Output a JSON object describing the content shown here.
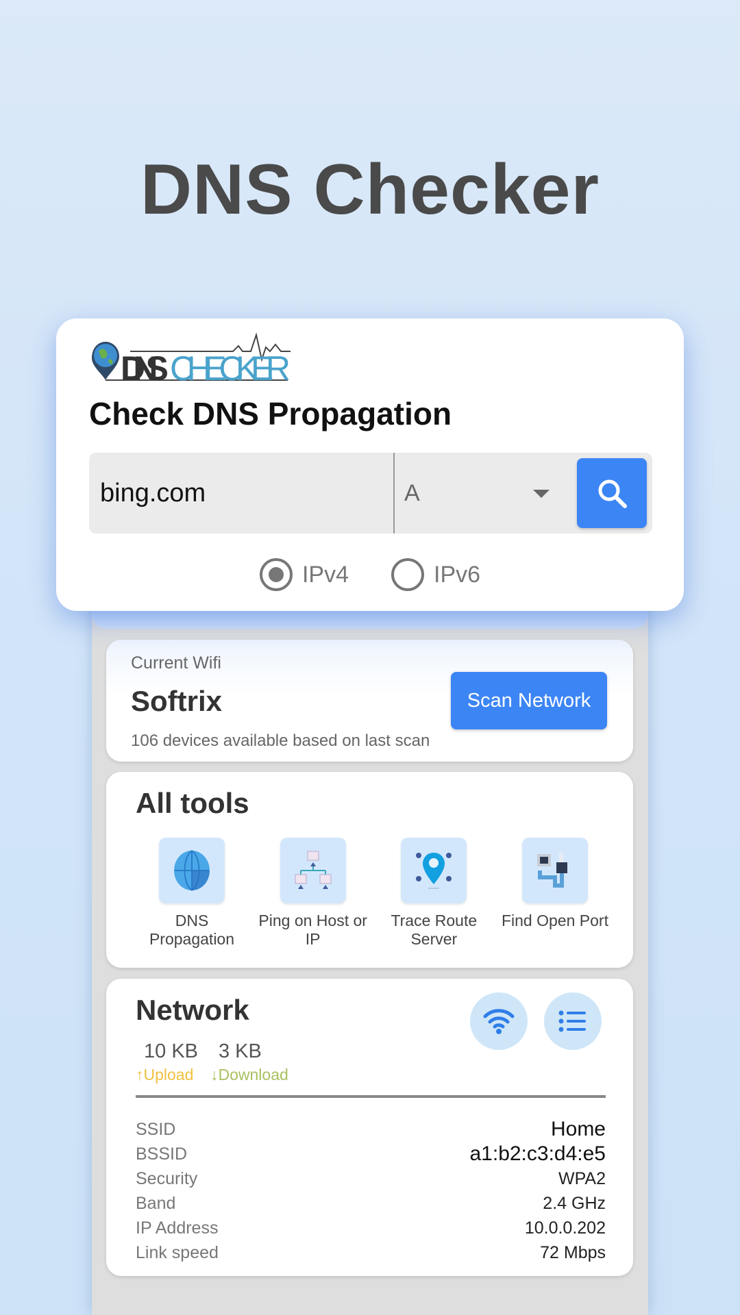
{
  "headline": "DNS Checker",
  "search_card": {
    "logo": {
      "dark_text": "DNS",
      "light_text": "CHECKER"
    },
    "title": "Check DNS Propagation",
    "domain_input": {
      "value": "bing.com",
      "placeholder": ""
    },
    "record_type": {
      "selected": "A"
    },
    "search_button_icon": "search-icon",
    "ip_options": [
      {
        "label": "IPv4",
        "checked": true
      },
      {
        "label": "IPv6",
        "checked": false
      }
    ]
  },
  "wifi": {
    "label": "Current Wifi",
    "name": "Softrix",
    "subtitle": "106 devices available based on last scan",
    "scan_button": "Scan Network"
  },
  "tools": {
    "title": "All tools",
    "items": [
      {
        "label": "DNS Propagation",
        "icon": "globe-icon"
      },
      {
        "label": "Ping on Host or IP",
        "icon": "network-hierarchy-icon"
      },
      {
        "label": "Trace Route Server",
        "icon": "location-pin-icon"
      },
      {
        "label": "Find Open Port",
        "icon": "ethernet-port-icon"
      }
    ]
  },
  "network": {
    "title": "Network",
    "upload_value": "10 KB",
    "upload_label": "Upload",
    "download_value": "3 KB",
    "download_label": "Download",
    "details": [
      {
        "key": "SSID",
        "value": "Home"
      },
      {
        "key": "BSSID",
        "value": "a1:b2:c3:d4:e5"
      },
      {
        "key": "Security",
        "value": "WPA2"
      },
      {
        "key": "Band",
        "value": "2.4 GHz"
      },
      {
        "key": "IP Address",
        "value": "10.0.0.202"
      },
      {
        "key": "Link speed",
        "value": "72 Mbps"
      }
    ]
  },
  "colors": {
    "accent": "#3c85f5",
    "upload": "#f0c040",
    "download": "#a8c060"
  }
}
